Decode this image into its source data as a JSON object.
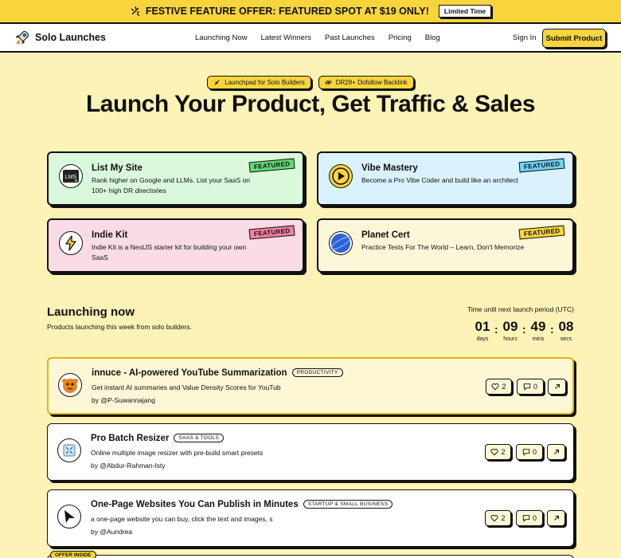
{
  "promo": {
    "text": "FESTIVE FEATURE OFFER: FEATURED SPOT AT $19 ONLY!",
    "badge": "Limited Time",
    "icon": "sparkle-icon"
  },
  "nav": {
    "brand": "Solo Launches",
    "brand_icon": "rocket-icon",
    "links": [
      "Launching Now",
      "Latest Winners",
      "Past Launches",
      "Pricing",
      "Blog"
    ],
    "signin": "Sign In",
    "submit": "Submit Product"
  },
  "hero": {
    "pills": [
      {
        "label": "Launchpad for Solo Builders",
        "icon": "rocket-icon"
      },
      {
        "label": "DR28+ Dofollow Backlink",
        "icon": "link-icon"
      }
    ],
    "title": "Launch Your Product, Get Traffic & Sales"
  },
  "featured": [
    {
      "name": "List My Site",
      "desc": "Rank higher on Google and LLMs. List your SaaS on 100+ high DR directories",
      "tag": "FEATURED",
      "bg": "#d9f8dc"
    },
    {
      "name": "Vibe Mastery",
      "desc": "Become a Pro Vibe Coder and build like an architect",
      "tag": "FEATURED",
      "bg": "#daf2fd"
    },
    {
      "name": "Indie Kit",
      "desc": "Indie Kit is a NextJS starter kit for building your own SaaS",
      "tag": "FEATURED",
      "bg": "#fbdbe6"
    },
    {
      "name": "Planet Cert",
      "desc": "Practice Tests For The World – Learn, Don't Memorize",
      "tag": "FEATURED",
      "bg": "#fdf7d9"
    }
  ],
  "launching": {
    "title": "Launching now",
    "subtitle": "Products launching this week from solo builders.",
    "countdown_label": "Time until next launch period (UTC)",
    "countdown": [
      {
        "value": "01",
        "unit": "days"
      },
      {
        "value": "09",
        "unit": "hours"
      },
      {
        "value": "49",
        "unit": "mins"
      },
      {
        "value": "08",
        "unit": "secs"
      }
    ]
  },
  "products": [
    {
      "name": "innuce - AI-powered YouTube Summarization",
      "category": "PRODUCTIVITY",
      "desc": "Get instant AI summaries and Value Density Scores for YouTub",
      "by": "by @P-Suwannajang",
      "likes": "2",
      "comments": "0"
    },
    {
      "name": "Pro Batch Resizer",
      "category": "SAAS & TOOLS",
      "desc": "Online multiple image resizer with pre-build smart presets",
      "by": "by @Abdur-Rahman-Isty",
      "likes": "2",
      "comments": "0"
    },
    {
      "name": "One-Page Websites You Can Publish in Minutes",
      "category": "STARTUP & SMALL BUSINESS",
      "desc": "a one-page website you can buy, click the text and images, s",
      "by": "by @Aundrea",
      "likes": "2",
      "comments": "0"
    }
  ],
  "offer_tag": "OFFER INSIDE",
  "colors": {
    "accent": "#f8d53c",
    "background": "#fdf3b6",
    "highlight_border": "#e3b50a"
  }
}
